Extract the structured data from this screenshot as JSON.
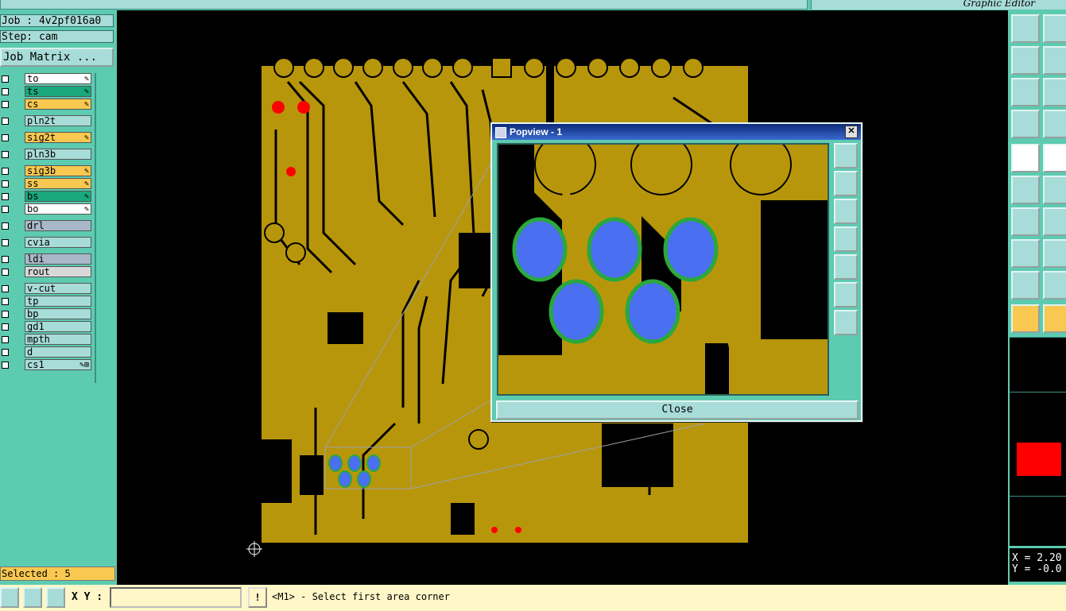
{
  "app": {
    "title": "Graphic Editor"
  },
  "job": {
    "name": "Job : 4v2pf016a0",
    "step": "Step: cam",
    "matrix_button": "Job Matrix ..."
  },
  "layers": [
    {
      "name": "to",
      "bg": "#ffffff",
      "mark": "✎"
    },
    {
      "name": "ts",
      "bg": "#1aa87c",
      "mark": "✎"
    },
    {
      "name": "cs",
      "bg": "#f8c850",
      "mark": "✎"
    },
    {
      "name": "pln2t",
      "bg": "#a8dcd8",
      "mark": ""
    },
    {
      "name": "sig2t",
      "bg": "#f8c850",
      "mark": "✎"
    },
    {
      "name": "pln3b",
      "bg": "#a8dcd8",
      "mark": ""
    },
    {
      "name": "sig3b",
      "bg": "#f8c850",
      "mark": "✎"
    },
    {
      "name": "ss",
      "bg": "#f8c850",
      "mark": "✎"
    },
    {
      "name": "bs",
      "bg": "#1aa87c",
      "mark": "✎"
    },
    {
      "name": "bo",
      "bg": "#ffffff",
      "mark": "✎"
    },
    {
      "name": "drl",
      "bg": "#a8b8c8",
      "mark": ""
    },
    {
      "name": "cvia",
      "bg": "#a8dcd8",
      "mark": ""
    },
    {
      "name": "ldi",
      "bg": "#a8b8c8",
      "mark": ""
    },
    {
      "name": "rout",
      "bg": "#d8d8d8",
      "mark": ""
    },
    {
      "name": "v-cut",
      "bg": "#a8dcd8",
      "mark": ""
    },
    {
      "name": "tp",
      "bg": "#a8dcd8",
      "mark": ""
    },
    {
      "name": "bp",
      "bg": "#a8dcd8",
      "mark": ""
    },
    {
      "name": "gd1",
      "bg": "#a8dcd8",
      "mark": ""
    },
    {
      "name": "mpth",
      "bg": "#a8dcd8",
      "mark": ""
    },
    {
      "name": "d",
      "bg": "#a8dcd8",
      "mark": ""
    },
    {
      "name": "cs1",
      "bg": "#a8dcd8",
      "mark": "✎⊞"
    }
  ],
  "status": {
    "selected": "Selected : 5"
  },
  "bottom": {
    "xy_label": "X Y :",
    "xy_value": "",
    "bang": "!",
    "message": "<M1> - Select first area corner"
  },
  "coords": {
    "x": "X = 2.20",
    "y": "Y = -0.0"
  },
  "popview": {
    "title": "Popview - 1",
    "close_label": "Close",
    "close_x": "✕"
  },
  "colors": {
    "copper": "#b8960c",
    "pad": "#4a6ff0",
    "mask": "#2aa83c",
    "highlight": "#ff0000",
    "panel": "#5dcbb0",
    "button": "#a8dcd8"
  }
}
